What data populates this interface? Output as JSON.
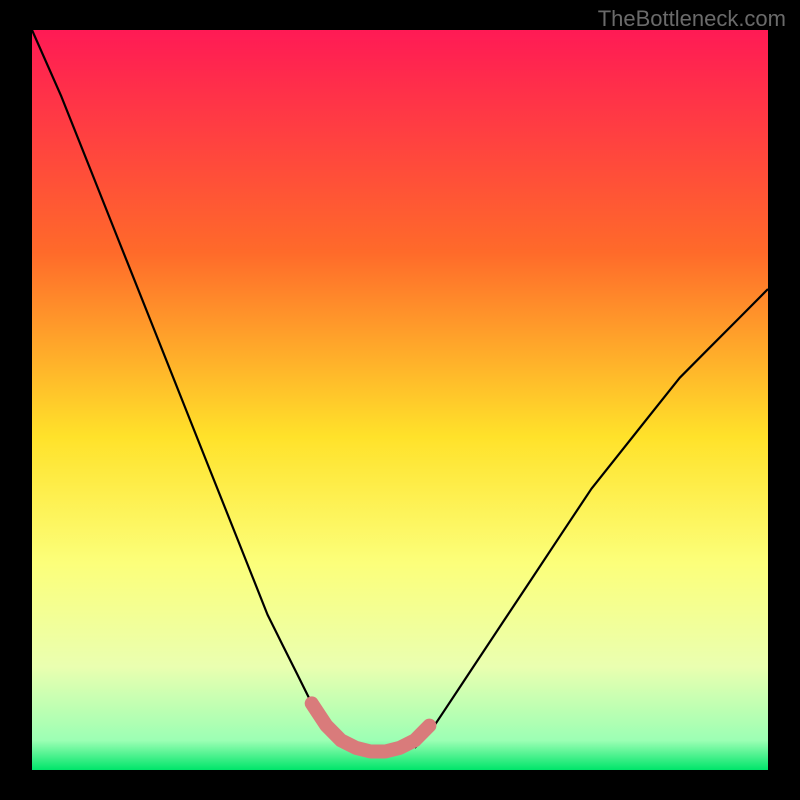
{
  "watermark": "TheBottleneck.com",
  "chart_data": {
    "type": "line",
    "title": "",
    "xlabel": "",
    "ylabel": "",
    "xlim": [
      0,
      100
    ],
    "ylim": [
      0,
      100
    ],
    "gradient_stops": [
      {
        "offset": 0,
        "color": "#ff1a55"
      },
      {
        "offset": 30,
        "color": "#ff6a2a"
      },
      {
        "offset": 55,
        "color": "#ffe22a"
      },
      {
        "offset": 72,
        "color": "#fcff7a"
      },
      {
        "offset": 86,
        "color": "#eaffb0"
      },
      {
        "offset": 96,
        "color": "#9cffb4"
      },
      {
        "offset": 100,
        "color": "#00e56a"
      }
    ],
    "series": [
      {
        "name": "left-arm",
        "color": "#000000",
        "x": [
          0,
          4,
          8,
          12,
          16,
          20,
          24,
          28,
          30,
          32,
          34,
          36,
          38,
          40,
          42,
          44
        ],
        "y": [
          100,
          91,
          81,
          71,
          61,
          51,
          41,
          31,
          26,
          21,
          17,
          13,
          9,
          6,
          4,
          3
        ]
      },
      {
        "name": "right-arm",
        "color": "#000000",
        "x": [
          52,
          54,
          56,
          58,
          60,
          64,
          68,
          72,
          76,
          80,
          84,
          88,
          92,
          96,
          100
        ],
        "y": [
          3,
          5,
          8,
          11,
          14,
          20,
          26,
          32,
          38,
          43,
          48,
          53,
          57,
          61,
          65
        ]
      },
      {
        "name": "valley-highlight",
        "color": "#d97b7b",
        "thick": true,
        "x": [
          38,
          40,
          42,
          44,
          46,
          48,
          50,
          52,
          54
        ],
        "y": [
          9,
          6,
          4,
          3,
          2.5,
          2.5,
          3,
          4,
          6
        ]
      }
    ]
  }
}
